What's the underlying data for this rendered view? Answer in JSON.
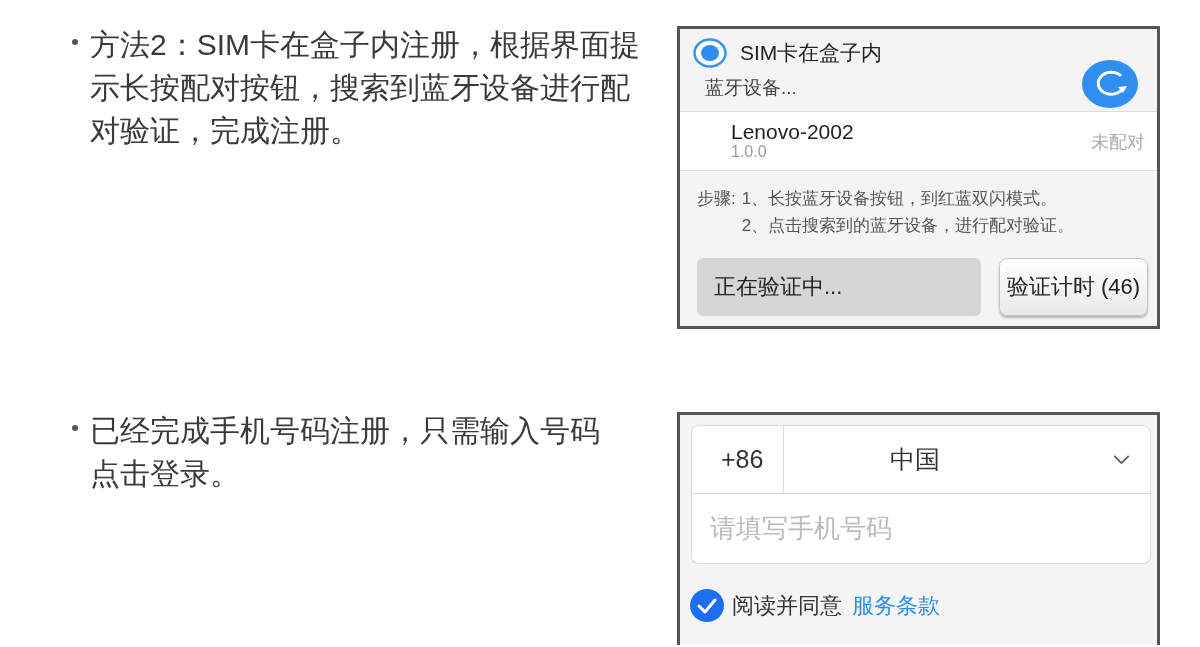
{
  "instructions": [
    {
      "kind": "bluetooth_pairing",
      "text": "方法2：SIM卡在盒子内注册，根据界面提示长按配对按钮，搜索到蓝牙设备进行配对验证，完成注册。",
      "screen": {
        "option": {
          "label": "SIM卡在盒子内",
          "selected": true
        },
        "status": "蓝牙设备...",
        "devices": [
          {
            "name": "Lenovo-2002",
            "version": "1.0.0",
            "state": "未配对"
          }
        ],
        "steps": {
          "label": "步骤:",
          "items": [
            "1、长按蓝牙设备按钮，到红蓝双闪模式。",
            "2、点击搜索到的蓝牙设备，进行配对验证。"
          ]
        },
        "buttons": [
          {
            "kind": "status",
            "label": "正在验证中..."
          },
          {
            "kind": "timer",
            "label": "验证计时 (46)"
          }
        ]
      }
    },
    {
      "kind": "phone_login",
      "text": "已经完成手机号码注册，只需输入号码点击登录。",
      "screen": {
        "country_code": "+86",
        "country": "中国",
        "phone_field": {
          "placeholder": "请填写手机号码"
        },
        "agreement": {
          "checked": true,
          "label": "阅读并同意",
          "link": "服务条款"
        }
      }
    }
  ]
}
